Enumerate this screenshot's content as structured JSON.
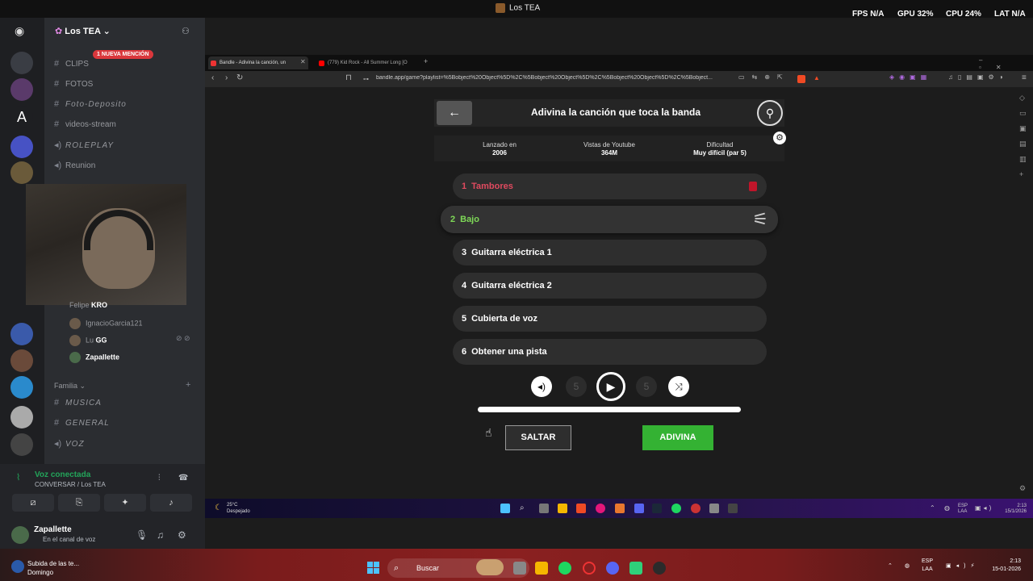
{
  "os_bar": {
    "title": "Los TEA",
    "stats": [
      {
        "label": "FPS",
        "value": "N/A"
      },
      {
        "label": "GPU",
        "value": "32%"
      },
      {
        "label": "CPU",
        "value": "24%"
      },
      {
        "label": "LAT",
        "value": "N/A"
      }
    ]
  },
  "discord": {
    "server_name": "Los TEA",
    "mention_badge": "1 NUEVA MENCIÓN",
    "channels": [
      {
        "name": "CLIPS",
        "icon": "hash-icon"
      },
      {
        "name": "FOTOS",
        "icon": "hash-icon"
      },
      {
        "name": "Foto-Deposito",
        "icon": "hash-icon"
      },
      {
        "name": "videos-stream",
        "icon": "hash-icon"
      },
      {
        "name": "ROLEPLAY",
        "icon": "speaker-icon"
      },
      {
        "name": "Reunion",
        "icon": "speaker-icon"
      }
    ],
    "members": [
      {
        "name": "Felipe",
        "tag": "KRO"
      },
      {
        "name": "IgnacioGarcia121",
        "tag": ""
      },
      {
        "name": "Lu",
        "tag": "GG"
      },
      {
        "name": "Zapallette",
        "tag": ""
      }
    ],
    "category": "Familia",
    "channels2": [
      {
        "name": "MUSICA",
        "icon": "hash-icon"
      },
      {
        "name": "GENERAL",
        "icon": "hash-icon"
      },
      {
        "name": "VOZ",
        "icon": "speaker-icon"
      }
    ],
    "voice": {
      "status": "Voz conectada",
      "channel": "CONVERSAR / Los TEA"
    },
    "user": {
      "name": "Zapallette",
      "status": "En el canal de voz"
    }
  },
  "browser": {
    "tabs": [
      {
        "title": "Bandle - Adivina la canción, un",
        "active": true
      },
      {
        "title": "(779) Kid Rock - All Summer Long [O",
        "active": false
      }
    ],
    "url": "bandle.app/game?playlist=%5Bobject%20Object%5D%2C%5Bobject%20Object%5D%2C%5Bobject%20Object%5D%2C%5Bobject..."
  },
  "game": {
    "title": "Adivina la canción que toca la banda",
    "info": [
      {
        "label": "Lanzado en",
        "value": "2006"
      },
      {
        "label": "Vistas de Youtube",
        "value": "364M"
      },
      {
        "label": "Dificultad",
        "value": "Muy difícil (par 5)"
      }
    ],
    "tracks": [
      {
        "num": "1",
        "label": "Tambores",
        "state": "failed"
      },
      {
        "num": "2",
        "label": "Bajo",
        "state": "active"
      },
      {
        "num": "3",
        "label": "Guitarra eléctrica 1",
        "state": "locked"
      },
      {
        "num": "4",
        "label": "Guitarra eléctrica 2",
        "state": "locked"
      },
      {
        "num": "5",
        "label": "Cubierta de voz",
        "state": "locked"
      },
      {
        "num": "6",
        "label": "Obtener una pista",
        "state": "locked"
      }
    ],
    "controls": {
      "rewind": "5",
      "forward": "5"
    },
    "progress": 1.0,
    "skip_label": "SALTAR",
    "guess_label": "ADIVINA",
    "accent_green": "#34b233",
    "accent_red": "#e04a5f"
  },
  "inner_taskbar": {
    "weather_temp": "25°C",
    "weather_desc": "Despejado",
    "lang": "ESP",
    "lang_sub": "LAA",
    "time": "2:13",
    "date": "15/1/2026"
  },
  "taskbar": {
    "notif_title": "Subida de las te...",
    "notif_sub": "Domingo",
    "search_placeholder": "Buscar",
    "lang": "ESP",
    "lang_sub": "LAA",
    "time": "2:13",
    "date": "15-01-2026"
  }
}
